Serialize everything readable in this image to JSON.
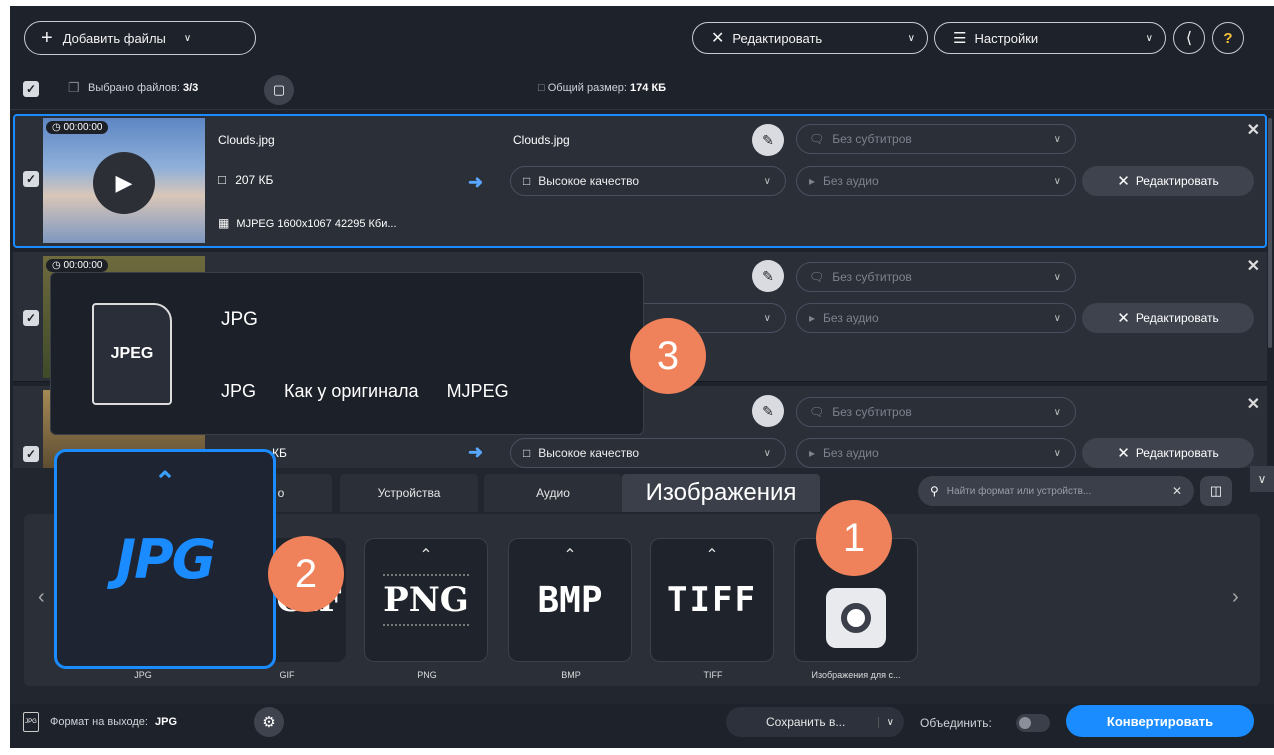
{
  "toolbar": {
    "add_files": "Добавить файлы",
    "edit": "Редактировать",
    "settings": "Настройки",
    "help": "?"
  },
  "selection": {
    "selected_label": "Выбрано файлов:",
    "selected_count": "3/3",
    "total_label": "Общий размер:",
    "total_size": "174 КБ"
  },
  "files": [
    {
      "duration": "00:00:00",
      "name": "Clouds.jpg",
      "size": "207 КБ",
      "codec": "MJPEG 1600x1067 42295 Кби...",
      "output_name": "Clouds.jpg",
      "quality": "Высокое качество",
      "subtitles": "Без субтитров",
      "audio": "Без аудио",
      "edit": "Редактировать"
    },
    {
      "duration": "00:00:00",
      "subtitles": "Без субтитров",
      "audio": "Без аудио",
      "edit": "Редактировать"
    },
    {
      "size": "КБ",
      "quality": "Высокое качество",
      "subtitles": "Без субтитров",
      "audio": "Без аудио",
      "edit": "Редактировать"
    }
  ],
  "tooltip": {
    "icon_text": "JPEG",
    "title": "JPG",
    "format": "JPG",
    "resolution": "Как у оригинала",
    "codec": "MJPEG"
  },
  "tabs": [
    "о",
    "Устройства",
    "Аудио",
    "Изображения"
  ],
  "search_placeholder": "Найти формат или устройств...",
  "formats": [
    {
      "logo": "JPG",
      "label": "JPG"
    },
    {
      "logo": "GIF",
      "label": "GIF"
    },
    {
      "logo": "PNG",
      "label": "PNG"
    },
    {
      "logo": "BMP",
      "label": "BMP"
    },
    {
      "logo": "TIFF",
      "label": "TIFF"
    },
    {
      "logo": "",
      "label": "Изображения для с..."
    }
  ],
  "badges": [
    "1",
    "2",
    "3"
  ],
  "footer": {
    "output_label": "Формат на выходе:",
    "output_value": "JPG",
    "save_to": "Сохранить в...",
    "merge": "Объединить:",
    "convert": "Конвертировать"
  },
  "colors": {
    "accent": "#1a8cff",
    "badge": "#f0825b",
    "background": "#1e222a"
  }
}
